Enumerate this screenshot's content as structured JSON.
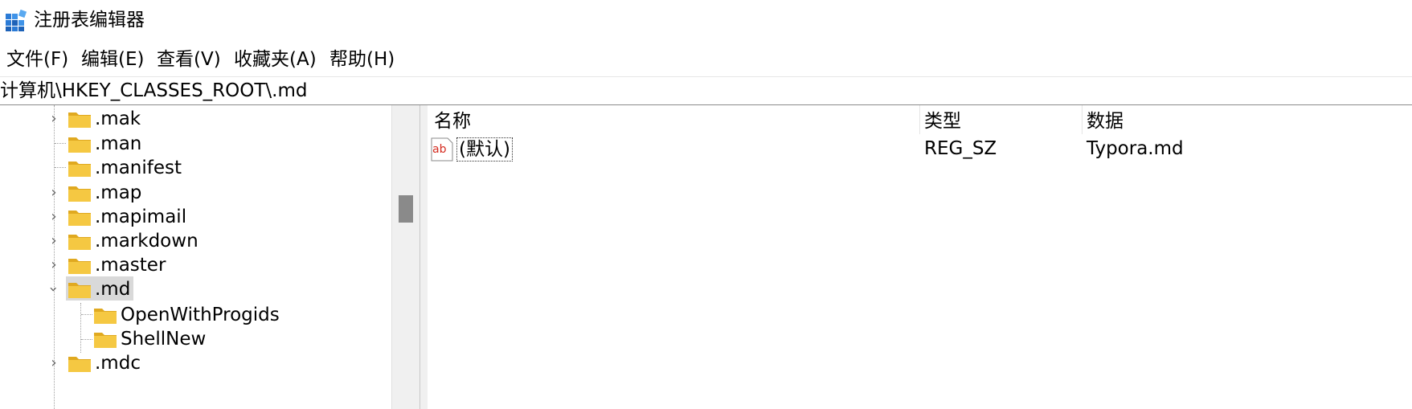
{
  "window": {
    "title": "注册表编辑器"
  },
  "menu": {
    "items": [
      "文件(F)",
      "编辑(E)",
      "查看(V)",
      "收藏夹(A)",
      "帮助(H)"
    ]
  },
  "address": {
    "path": "计算机\\HKEY_CLASSES_ROOT\\.md"
  },
  "tree": {
    "items": [
      {
        "label": ".mak",
        "expander": "collapsed"
      },
      {
        "label": ".man",
        "expander": "none"
      },
      {
        "label": ".manifest",
        "expander": "none"
      },
      {
        "label": ".map",
        "expander": "collapsed"
      },
      {
        "label": ".mapimail",
        "expander": "collapsed"
      },
      {
        "label": ".markdown",
        "expander": "collapsed"
      },
      {
        "label": ".master",
        "expander": "collapsed"
      },
      {
        "label": ".md",
        "expander": "expanded",
        "selected": true
      },
      {
        "label": "OpenWithProgids",
        "expander": "none",
        "child": true
      },
      {
        "label": "ShellNew",
        "expander": "none",
        "child": true
      },
      {
        "label": ".mdc",
        "expander": "collapsed"
      }
    ]
  },
  "list": {
    "columns": [
      "名称",
      "类型",
      "数据"
    ],
    "rows": [
      {
        "icon": "ab",
        "name": "(默认)",
        "type": "REG_SZ",
        "data": "Typora.md"
      }
    ]
  },
  "colors": {
    "folder": "#f5c842",
    "folder_dark": "#e0a920",
    "selection": "#d9d9d9",
    "value_icon_red": "#d42a1e"
  }
}
